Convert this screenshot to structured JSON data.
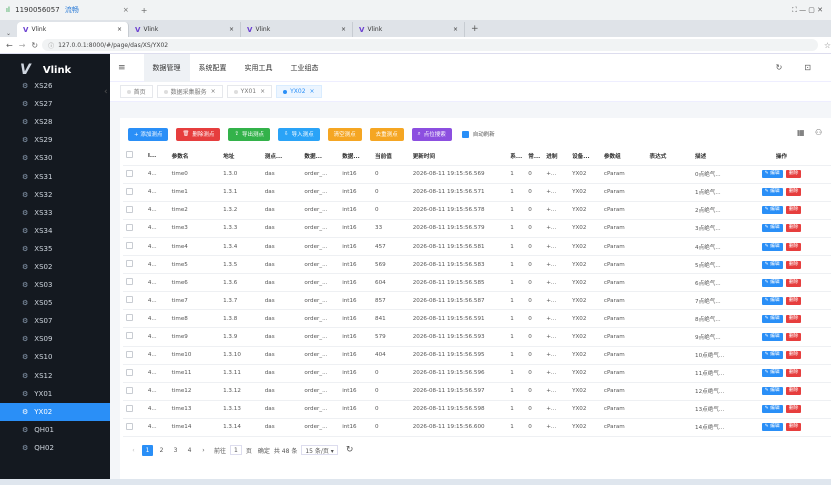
{
  "window": {
    "phone": "1190056057",
    "carrier": "流畅",
    "plus": "+",
    "controls": "⛶  —  ▢  ✕"
  },
  "browser_tabs": [
    {
      "label": "Vlink",
      "close": "×"
    },
    {
      "label": "Vlink",
      "close": "×"
    },
    {
      "label": "Vlink",
      "close": "×"
    },
    {
      "label": "Vlink",
      "close": "×"
    }
  ],
  "new_tab": "+",
  "address": {
    "url": "127.0.0.1:8000/#/page/das/XS/YX02"
  },
  "sidebar": {
    "logo": "Vlink",
    "items": [
      "XS26",
      "XS27",
      "XS28",
      "XS29",
      "XS30",
      "XS31",
      "XS32",
      "XS33",
      "XS34",
      "XS35",
      "XS02",
      "XS03",
      "XS05",
      "XS07",
      "XS09",
      "XS10",
      "XS12",
      "YX01",
      "YX02",
      "QH01",
      "QH02"
    ],
    "active_index": 18
  },
  "header": {
    "collapse": "≡",
    "menus": [
      "数据管理",
      "系统配置",
      "实用工具",
      "工业组态"
    ],
    "active_menu": 0,
    "refresh": "↻",
    "right_icon": "⊡"
  },
  "tags": {
    "back": "‹",
    "items": [
      "首页",
      "数据采集服务",
      "YX01",
      "YX02"
    ],
    "active_index": 3
  },
  "toolbar": {
    "add": "+ 添加测点",
    "del": "删除测点",
    "export": "导出测点",
    "import": "导入测点",
    "clear": "清空测点",
    "dedupe": "去重测点",
    "search": "点位搜索",
    "auto_refresh": "自动刷新"
  },
  "table": {
    "columns": [
      "",
      "I...",
      "参数名",
      "地址",
      "测点...",
      "数据...",
      "数据...",
      "当前值",
      "更新时间",
      "系...",
      "常...",
      "进制",
      "设备...",
      "参数组",
      "表达式",
      "描述",
      "操作"
    ],
    "edit_label": "✎ 编辑",
    "delete_label": "删除",
    "rows": [
      [
        "4...",
        "time0",
        "1.3.0",
        "das",
        "order_...",
        "int16",
        "0",
        "2026-08-11 19:15:56.569",
        "1",
        "0",
        "+...",
        "YX02",
        "cParam",
        "",
        "0点绝气..."
      ],
      [
        "4...",
        "time1",
        "1.3.1",
        "das",
        "order_...",
        "int16",
        "0",
        "2026-08-11 19:15:56.571",
        "1",
        "0",
        "+...",
        "YX02",
        "cParam",
        "",
        "1点绝气..."
      ],
      [
        "4...",
        "time2",
        "1.3.2",
        "das",
        "order_...",
        "int16",
        "0",
        "2026-08-11 19:15:56.578",
        "1",
        "0",
        "+...",
        "YX02",
        "cParam",
        "",
        "2点绝气..."
      ],
      [
        "4...",
        "time3",
        "1.3.3",
        "das",
        "order_...",
        "int16",
        "33",
        "2026-08-11 19:15:56.579",
        "1",
        "0",
        "+...",
        "YX02",
        "cParam",
        "",
        "3点绝气..."
      ],
      [
        "4...",
        "time4",
        "1.3.4",
        "das",
        "order_...",
        "int16",
        "457",
        "2026-08-11 19:15:56.581",
        "1",
        "0",
        "+...",
        "YX02",
        "cParam",
        "",
        "4点绝气..."
      ],
      [
        "4...",
        "time5",
        "1.3.5",
        "das",
        "order_...",
        "int16",
        "569",
        "2026-08-11 19:15:56.583",
        "1",
        "0",
        "+...",
        "YX02",
        "cParam",
        "",
        "5点绝气..."
      ],
      [
        "4...",
        "time6",
        "1.3.6",
        "das",
        "order_...",
        "int16",
        "604",
        "2026-08-11 19:15:56.585",
        "1",
        "0",
        "+...",
        "YX02",
        "cParam",
        "",
        "6点绝气..."
      ],
      [
        "4...",
        "time7",
        "1.3.7",
        "das",
        "order_...",
        "int16",
        "857",
        "2026-08-11 19:15:56.587",
        "1",
        "0",
        "+...",
        "YX02",
        "cParam",
        "",
        "7点绝气..."
      ],
      [
        "4...",
        "time8",
        "1.3.8",
        "das",
        "order_...",
        "int16",
        "841",
        "2026-08-11 19:15:56.591",
        "1",
        "0",
        "+...",
        "YX02",
        "cParam",
        "",
        "8点绝气..."
      ],
      [
        "4...",
        "time9",
        "1.3.9",
        "das",
        "order_...",
        "int16",
        "579",
        "2026-08-11 19:15:56.593",
        "1",
        "0",
        "+...",
        "YX02",
        "cParam",
        "",
        "9点绝气..."
      ],
      [
        "4...",
        "time10",
        "1.3.10",
        "das",
        "order_...",
        "int16",
        "404",
        "2026-08-11 19:15:56.595",
        "1",
        "0",
        "+...",
        "YX02",
        "cParam",
        "",
        "10点绝气..."
      ],
      [
        "4...",
        "time11",
        "1.3.11",
        "das",
        "order_...",
        "int16",
        "0",
        "2026-08-11 19:15:56.596",
        "1",
        "0",
        "+...",
        "YX02",
        "cParam",
        "",
        "11点绝气..."
      ],
      [
        "4...",
        "time12",
        "1.3.12",
        "das",
        "order_...",
        "int16",
        "0",
        "2026-08-11 19:15:56.597",
        "1",
        "0",
        "+...",
        "YX02",
        "cParam",
        "",
        "12点绝气..."
      ],
      [
        "4...",
        "time13",
        "1.3.13",
        "das",
        "order_...",
        "int16",
        "0",
        "2026-08-11 19:15:56.598",
        "1",
        "0",
        "+...",
        "YX02",
        "cParam",
        "",
        "13点绝气..."
      ],
      [
        "4...",
        "time14",
        "1.3.14",
        "das",
        "order_...",
        "int16",
        "0",
        "2026-08-11 19:15:56.600",
        "1",
        "0",
        "+...",
        "YX02",
        "cParam",
        "",
        "14点绝气..."
      ]
    ]
  },
  "pager": {
    "prev": "‹",
    "pages": [
      "1",
      "2",
      "3",
      "4"
    ],
    "next": "›",
    "goto_label": "前往",
    "goto_value": "1",
    "page_unit": "页",
    "confirm": "确定",
    "total": "共 48 条",
    "page_size": "15 条/页 ▾",
    "refresh": "↻"
  },
  "colors": {
    "accent": "#2a8ff7",
    "sidebar_bg": "#141920",
    "danger": "#e63e3e"
  }
}
